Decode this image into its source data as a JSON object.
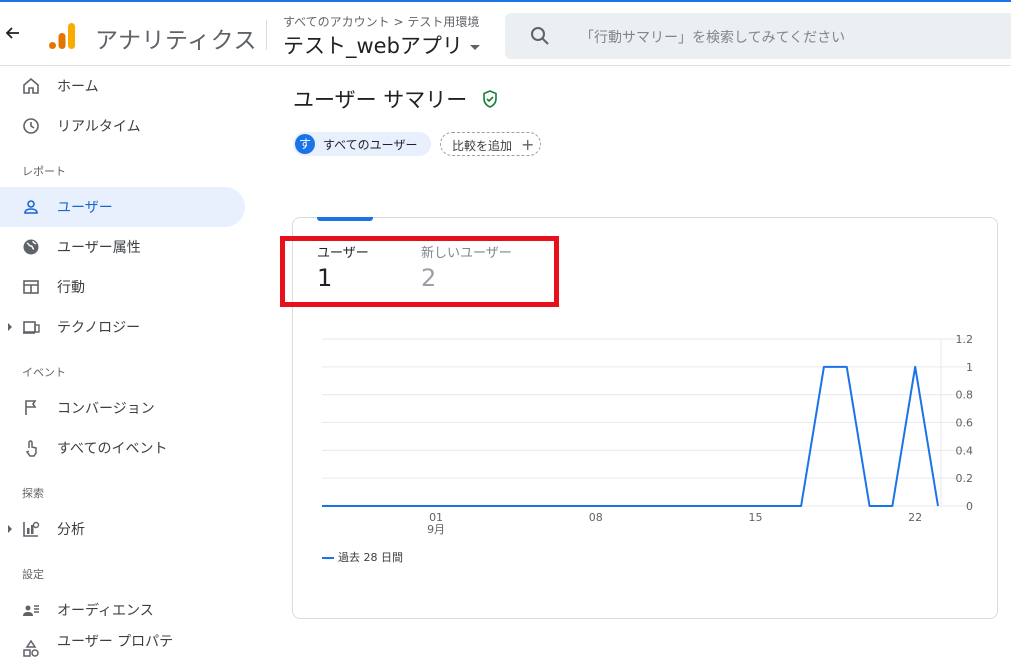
{
  "header": {
    "app_name": "アナリティクス",
    "breadcrumb": "すべてのアカウント > テスト用環境",
    "property": "テスト_webアプリ",
    "search_placeholder": "「行動サマリー」を検索してみてください"
  },
  "sidebar": {
    "items": [
      {
        "label": "ホーム",
        "icon": "home-icon"
      },
      {
        "label": "リアルタイム",
        "icon": "clock-icon"
      }
    ],
    "sections": {
      "reports": "レポート",
      "events": "イベント",
      "explore": "探索",
      "settings": "設定"
    },
    "report_items": [
      {
        "label": "ユーザー",
        "icon": "person-icon",
        "active": true
      },
      {
        "label": "ユーザー属性",
        "icon": "globe-icon"
      },
      {
        "label": "行動",
        "icon": "behavior-icon"
      },
      {
        "label": "テクノロジー",
        "icon": "devices-icon"
      }
    ],
    "event_items": [
      {
        "label": "コンバージョン",
        "icon": "flag-icon"
      },
      {
        "label": "すべてのイベント",
        "icon": "touch-icon"
      }
    ],
    "explore_items": [
      {
        "label": "分析",
        "icon": "analysis-icon"
      }
    ],
    "settings_items": [
      {
        "label": "オーディエンス",
        "icon": "audience-icon"
      },
      {
        "label": "ユーザー プロパテ",
        "icon": "shapes-icon"
      }
    ]
  },
  "main": {
    "title": "ユーザー サマリー",
    "chip_all_badge": "す",
    "chip_all": "すべてのユーザー",
    "chip_add": "比較を追加",
    "metric1_label": "ユーザー",
    "metric1_value": "1",
    "metric2_label": "新しいユーザー",
    "metric2_value": "2",
    "legend": "過去 28 日間"
  },
  "colors": {
    "accent": "#1a73e8",
    "highlight": "#e8101a",
    "verified": "#188038"
  },
  "chart_data": {
    "type": "line",
    "x_ticks": [
      "01",
      "08",
      "15",
      "22"
    ],
    "x_sub_label": "9月",
    "y_ticks": [
      "1.2",
      "1",
      "0.8",
      "0.6",
      "0.4",
      "0.2",
      "0"
    ],
    "ylim": [
      0,
      1.2
    ],
    "series": [
      {
        "name": "過去 28 日間",
        "values": [
          0,
          0,
          0,
          0,
          0,
          0,
          0,
          0,
          0,
          0,
          0,
          0,
          0,
          0,
          0,
          0,
          0,
          0,
          0,
          0,
          0,
          0,
          1,
          1,
          0,
          0,
          1,
          0
        ]
      }
    ]
  }
}
